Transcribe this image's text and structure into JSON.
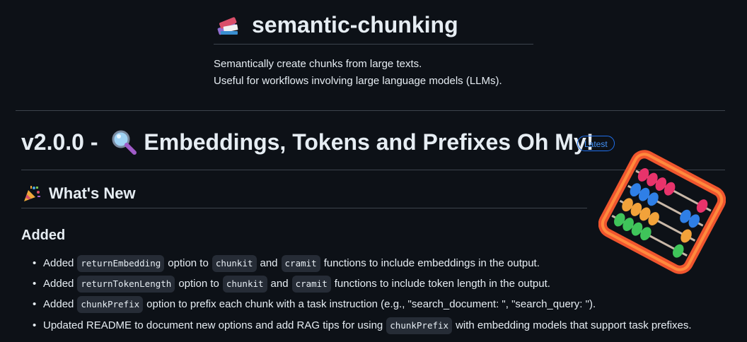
{
  "header": {
    "repo_title": "semantic-chunking",
    "description_line1": "Semantically create chunks from large texts.",
    "description_line2": "Useful for workflows involving large language models (LLMs)."
  },
  "release": {
    "version_prefix": "v2.0.0 - ",
    "title_suffix": "Embeddings, Tokens and Prefixes Oh My!",
    "badge": "Latest"
  },
  "whats_new": {
    "heading": "What's New"
  },
  "added": {
    "heading": "Added",
    "items": [
      {
        "p1": "Added",
        "c1": "returnEmbedding",
        "p2": "option to",
        "c2": "chunkit",
        "p3": "and",
        "c3": "cramit",
        "p4": "functions to include embeddings in the output."
      },
      {
        "p1": "Added",
        "c1": "returnTokenLength",
        "p2": "option to",
        "c2": "chunkit",
        "p3": "and",
        "c3": "cramit",
        "p4": "functions to include token length in the output."
      },
      {
        "p1": "Added",
        "c1": "chunkPrefix",
        "p2": "option to prefix each chunk with a task instruction (e.g., \"search_document: \", \"search_query: \")."
      },
      {
        "p1": "Updated README to document new options and add RAG tips for using",
        "c1": "chunkPrefix",
        "p2": "with embedding models that support task prefixes."
      }
    ]
  },
  "icons": {
    "repo": "books-icon",
    "magnifier": "magnifying-glass-icon",
    "party": "party-popper-icon",
    "abacus": "abacus-icon"
  },
  "colors": {
    "background": "#0d1117",
    "text": "#e6edf3",
    "badge": "#4493f8",
    "rule": "#3d444d"
  }
}
